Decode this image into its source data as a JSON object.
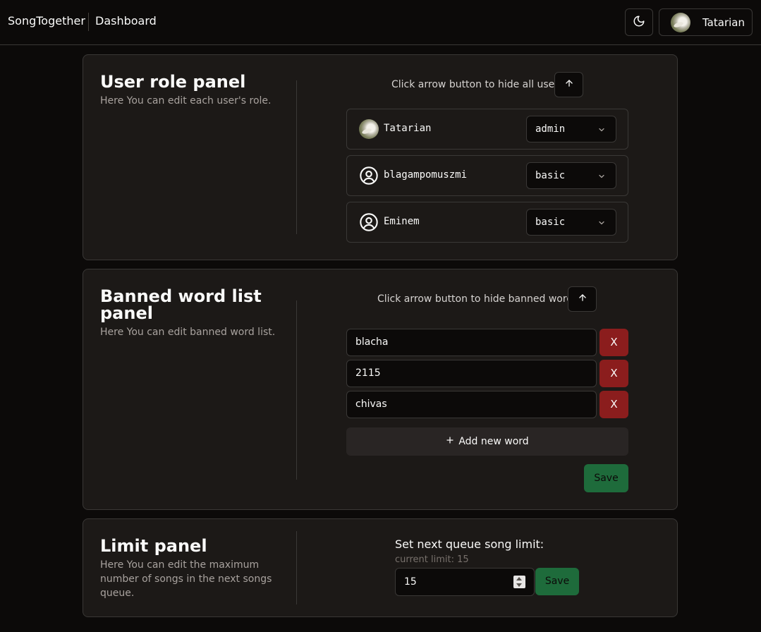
{
  "header": {
    "brand": "SongTogether",
    "breadcrumb": "Dashboard",
    "theme_icon": "moon-icon",
    "user_name": "Tatarian"
  },
  "user_role_panel": {
    "title": "User role panel",
    "description": "Here You can edit each user's role.",
    "hint": "Click arrow button to hide all users.",
    "toggle_icon": "arrow-up-icon",
    "users": [
      {
        "name": "Tatarian",
        "avatar": "photo",
        "role": "admin"
      },
      {
        "name": "blagampomuszmi",
        "avatar": "user-circle-icon",
        "role": "basic"
      },
      {
        "name": "Eminem",
        "avatar": "user-circle-icon",
        "role": "basic"
      }
    ]
  },
  "banned_words_panel": {
    "title_line1": "Banned word list",
    "title_line2": "panel",
    "description": "Here You can edit banned word list.",
    "hint": "Click arrow button to hide banned words.",
    "words": [
      "blacha",
      "2115",
      "chivas"
    ],
    "remove_label": "X",
    "add_label": "Add new word",
    "save_label": "Save"
  },
  "limit_panel": {
    "title": "Limit panel",
    "description_lines": [
      "Here You can edit the maximum",
      "number of songs in the next songs",
      "queue."
    ],
    "label": "Set next queue song limit:",
    "current_limit": "current limit: 15",
    "value": "15",
    "save_label": "Save"
  },
  "colors": {
    "background": "#0c0a09",
    "panel": "#1c1917",
    "border": "#3a3836",
    "danger": "#8b1d1d",
    "success": "#1e6b3b"
  }
}
